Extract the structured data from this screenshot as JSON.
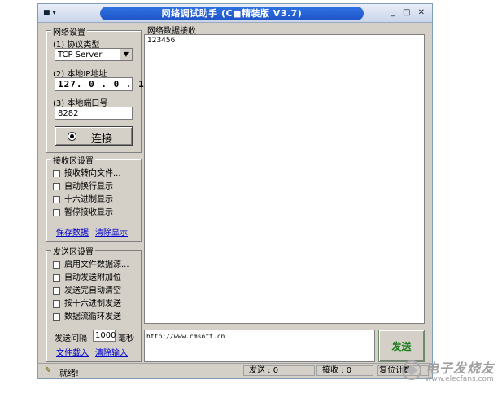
{
  "window": {
    "title": "网络调试助手 (C■精装版 V3.7)",
    "sysmenu": "■ ▾",
    "buttons": "_ □ ✕"
  },
  "network_settings": {
    "group_title": "网络设置",
    "protocol_label": "(1) 协议类型",
    "protocol_value": "TCP Server",
    "ip_label": "(2) 本地IP地址",
    "ip_value": "127. 0 . 0 . 1",
    "port_label": "(3) 本地端口号",
    "port_value": "8282",
    "connect_label": "连接"
  },
  "receive_settings": {
    "group_title": "接收区设置",
    "options": [
      "接收转向文件...",
      "自动换行显示",
      "十六进制显示",
      "暂停接收显示"
    ],
    "save_link": "保存数据",
    "clear_link": "清除显示"
  },
  "send_settings": {
    "group_title": "发送区设置",
    "options": [
      "启用文件数据源...",
      "自动发送附加位",
      "发送完自动清空",
      "按十六进制发送",
      "数据流循环发送"
    ],
    "interval_label": "发送间隔",
    "interval_value": "1000",
    "interval_unit": "毫秒",
    "load_link": "文件载入",
    "clear_input_link": "清除输入"
  },
  "receive_area": {
    "title": "网络数据接收",
    "content": "123456"
  },
  "send_area": {
    "content": "http://www.cmsoft.cn",
    "send_label": "发送"
  },
  "statusbar": {
    "ready": "就绪!",
    "sent": "发送 : 0",
    "received": "接收 : 0",
    "reset": "复位计数"
  },
  "watermark": {
    "text": "电子发烧友",
    "url": "www.elecfans.com"
  }
}
